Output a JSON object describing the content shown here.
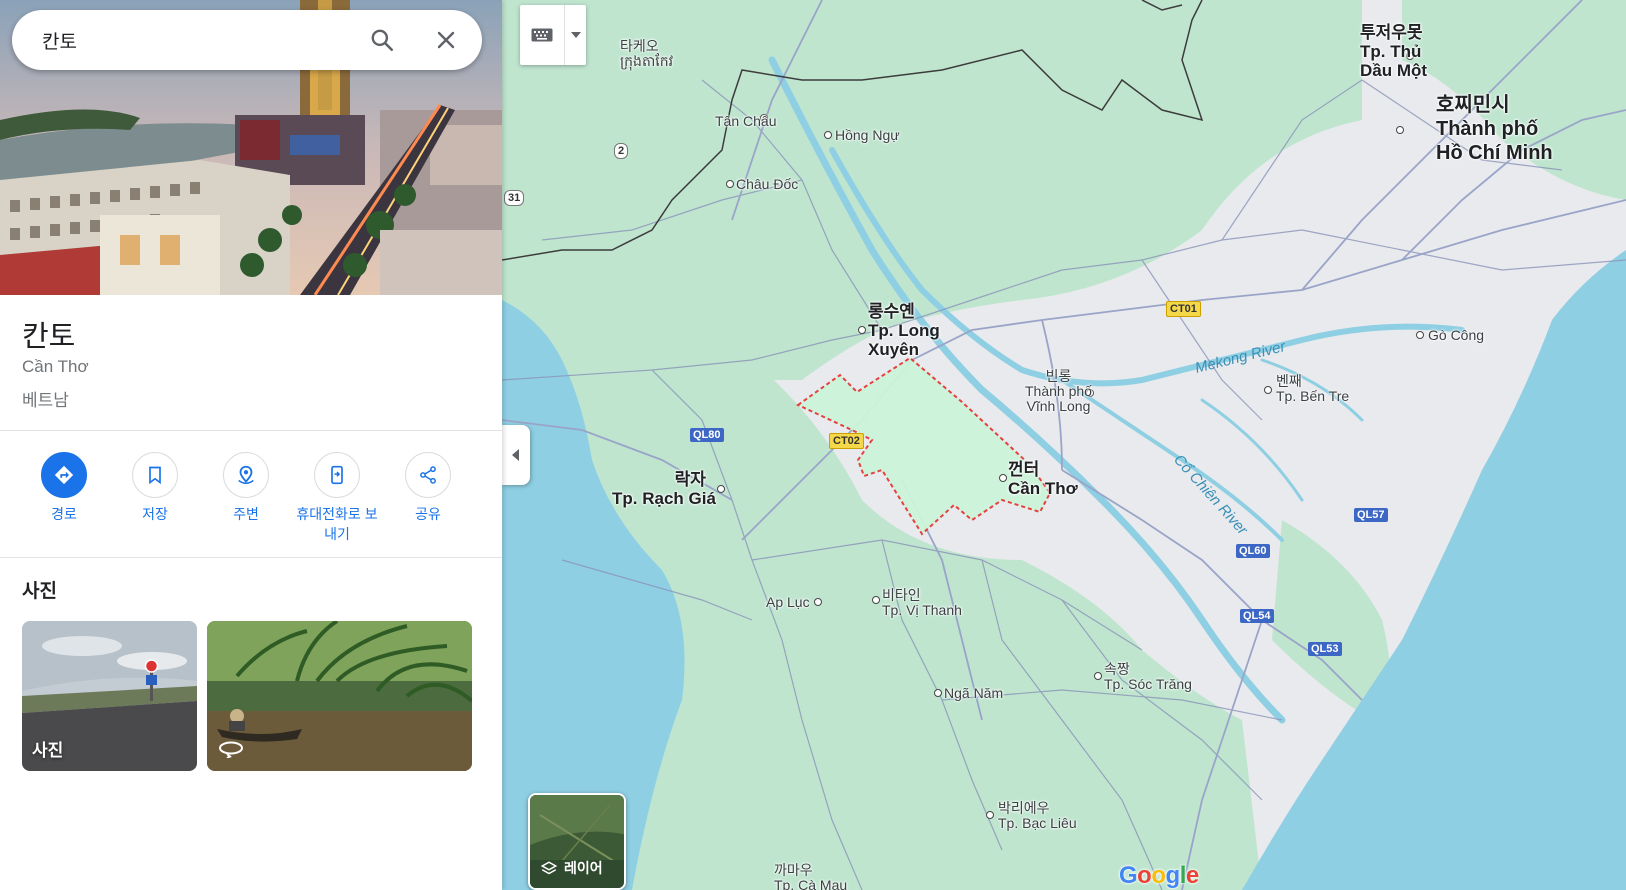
{
  "search": {
    "value": "칸토",
    "search_icon": "search-icon",
    "close_icon": "close-icon"
  },
  "place": {
    "title": "칸토",
    "region": "Cần Thơ",
    "country": "베트남"
  },
  "actions": [
    {
      "label": "경로",
      "icon": "directions-icon"
    },
    {
      "label": "저장",
      "icon": "bookmark-icon"
    },
    {
      "label": "주변",
      "icon": "nearby-icon"
    },
    {
      "label": "휴대전화로 보내기",
      "label_line1": "휴대전화로 보",
      "label_line2": "내기",
      "icon": "send-to-phone-icon"
    },
    {
      "label": "공유",
      "icon": "share-icon"
    }
  ],
  "photos": {
    "title": "사진",
    "photo1_label": "사진",
    "photo2_icon": "360-view-icon"
  },
  "map": {
    "layers_label": "레이어",
    "attribution": "Google",
    "labels": {
      "hcmc_ko": "호찌민시",
      "hcmc_vi1": "Thành phố",
      "hcmc_vi2": "Hồ Chí Minh",
      "tdm_ko": "투저우못",
      "tdm_vi1": "Tp. Thủ",
      "tdm_vi2": "Dầu Một",
      "takeo_ko": "타케오",
      "takeo_km": "ក្រុងតាកែវ",
      "tanchau": "Tân Châu",
      "hongngu": "Hồng Ngự",
      "chaudoc": "Châu Đốc",
      "longxuyen_ko": "롱수옌",
      "longxuyen_vi1": "Tp. Long",
      "longxuyen_vi2": "Xuyên",
      "vinhlong_ko": "빈롱",
      "vinhlong_vi1": "Thành phố",
      "vinhlong_vi2": "Vĩnh Long",
      "gocong": "Gò Công",
      "bentre_ko": "벤째",
      "bentre_vi": "Tp. Bến Tre",
      "cantho_ko": "껀터",
      "cantho_vi": "Cần Thơ",
      "rachgia_ko": "락자",
      "rachgia_vi": "Tp. Rạch Giá",
      "apluc": "Ap Lục",
      "vithanh_ko": "비타인",
      "vithanh_vi": "Tp. Vị Thanh",
      "nganam": "Ngã Năm",
      "soctrang_ko": "속짱",
      "soctrang_vi": "Tp. Sóc Trăng",
      "baclieu_ko": "박리에우",
      "baclieu_vi": "Tp. Bạc Liêu",
      "camau_ko": "까마우",
      "camau_vi": "Tp. Cà Mau",
      "mekong": "Mekong River",
      "cochien": "Cổ Chiên River"
    },
    "shields": {
      "r2": "2",
      "r31": "31",
      "ql80": "QL80",
      "ct02": "CT02",
      "ct01": "CT01",
      "ql57": "QL57",
      "ql60": "QL60",
      "ql54": "QL54",
      "ql53": "QL53"
    },
    "colors": {
      "land": "#e8eaed",
      "green": "#bfe5cf",
      "water": "#8fcfe3",
      "highlight_border": "#e53935"
    }
  }
}
